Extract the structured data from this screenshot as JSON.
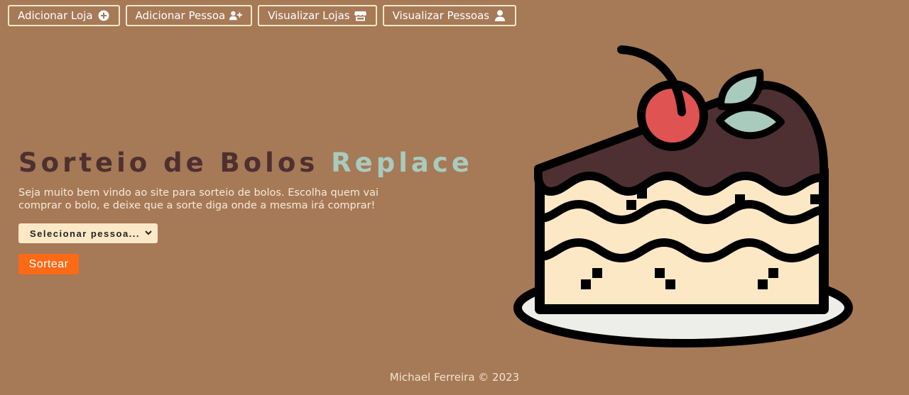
{
  "nav": {
    "items": [
      {
        "label": "Adicionar Loja",
        "icon": "plus-circle-icon"
      },
      {
        "label": "Adicionar Pessoa",
        "icon": "user-plus-icon"
      },
      {
        "label": "Visualizar Lojas",
        "icon": "store-icon"
      },
      {
        "label": "Visualizar Pessoas",
        "icon": "user-icon"
      }
    ]
  },
  "hero": {
    "title_main": "Sorteio de Bolos ",
    "title_accent": "Replace",
    "subtitle": "Seja muito bem vindo ao site para sorteio de bolos. Escolha quem vai comprar o bolo, e deixe que a sorte diga onde a mesma irá comprar!",
    "select_value": "Selecionar pessoa...",
    "draw_label": "Sortear"
  },
  "footer": {
    "text": "Michael Ferreira © 2023"
  },
  "colors": {
    "background": "#a67957",
    "button_border": "#fbe8c6",
    "title": "#4e3030",
    "title_accent": "#a8cbbe",
    "draw_button": "#fc6a16",
    "select_background": "#fbe8c6"
  }
}
